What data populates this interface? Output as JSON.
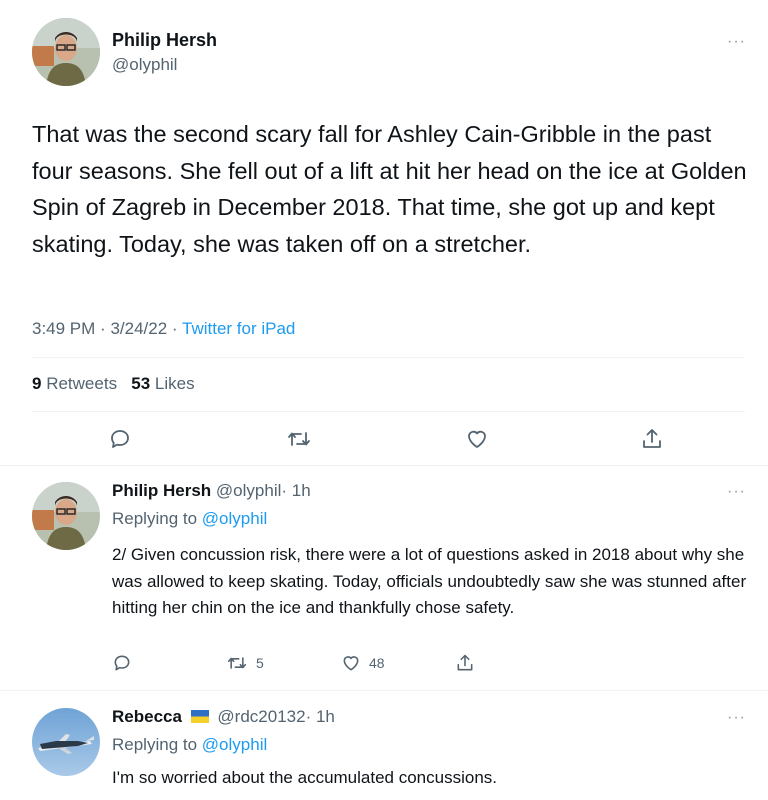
{
  "main_tweet": {
    "author_name": "Philip Hersh",
    "author_handle": "@olyphil",
    "text": "That was the second scary fall for Ashley Cain-Gribble in the past four seasons. She fell out of a lift at hit her head on the ice at Golden Spin of Zagreb in December 2018.  That time, she got up and kept skating.  Today, she was taken off on a stretcher.",
    "time": "3:49 PM",
    "date": "3/24/22",
    "separator": "·",
    "source": "Twitter for iPad",
    "retweets_count": "9",
    "retweets_label": "Retweets",
    "likes_count": "53",
    "likes_label": "Likes",
    "more_label": "···"
  },
  "replies": [
    {
      "author_name": "Philip Hersh",
      "author_handle": "@olyphil",
      "age": "· 1h",
      "replying_to_label": "Replying to",
      "replying_to_handle": "@olyphil",
      "text": "2/ Given concussion risk, there were a lot of questions asked in 2018 about why she was allowed to keep skating.  Today, officials undoubtedly saw she was stunned after hitting her chin on the ice and thankfully chose safety.",
      "retweets": "5",
      "likes": "48",
      "more_label": "···"
    },
    {
      "author_name": "Rebecca",
      "flag": "Ukraine flag",
      "author_handle": "@rdc20132",
      "age": "· 1h",
      "replying_to_label": "Replying to",
      "replying_to_handle": "@olyphil",
      "text": "I'm so worried about the accumulated concussions.",
      "more_label": "···"
    }
  ],
  "icons": {
    "reply": "reply-icon",
    "retweet": "retweet-icon",
    "like": "heart-icon",
    "share": "share-icon",
    "more": "more-icon"
  },
  "colors": {
    "text": "#0f1419",
    "secondary": "#536471",
    "link": "#1d9bf0",
    "divider": "#eff3f4"
  }
}
